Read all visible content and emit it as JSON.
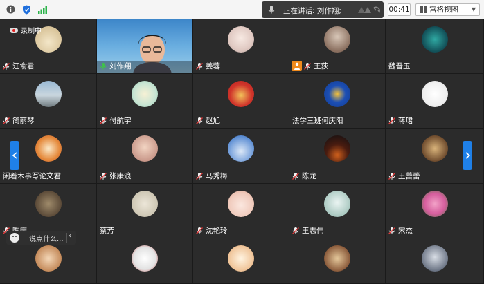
{
  "topbar": {
    "speaking_label": "正在讲话: 刘作翔;",
    "timer": "00:41",
    "view_label": "宫格视图"
  },
  "recording_label": "录制中",
  "chat": {
    "placeholder": "说点什么..."
  },
  "participants": [
    {
      "name": "汪俞君",
      "muted": true
    },
    {
      "name": "刘作翔",
      "muted": false,
      "video": true
    },
    {
      "name": "姜蓉",
      "muted": true
    },
    {
      "name": "王荻",
      "muted": true,
      "hand": true
    },
    {
      "name": "魏晋玉",
      "muted": false
    },
    {
      "name": "简丽琴",
      "muted": true
    },
    {
      "name": "付航宇",
      "muted": true
    },
    {
      "name": "赵旭",
      "muted": true
    },
    {
      "name": "法学三班何庆阳",
      "muted": false
    },
    {
      "name": "蒋珺",
      "muted": true
    },
    {
      "name": "闲着木事写论文君",
      "muted": false
    },
    {
      "name": "张康浪",
      "muted": true
    },
    {
      "name": "马秀梅",
      "muted": true
    },
    {
      "name": "陈龙",
      "muted": true
    },
    {
      "name": "王蕾蕾",
      "muted": true
    },
    {
      "name": "陶庆",
      "muted": true
    },
    {
      "name": "蔡芳",
      "muted": false
    },
    {
      "name": "沈艳玲",
      "muted": true
    },
    {
      "name": "王志伟",
      "muted": true
    },
    {
      "name": "宋杰",
      "muted": true
    },
    {
      "name": "",
      "muted": false
    },
    {
      "name": "",
      "muted": false
    },
    {
      "name": "",
      "muted": false
    },
    {
      "name": "",
      "muted": false
    },
    {
      "name": "",
      "muted": false
    }
  ],
  "colors": {
    "tile_bg": "#2b2b2b",
    "accent_blue": "#1f80e8",
    "hand_orange": "#f08a1c",
    "mic_green": "#3fc24a",
    "mic_red": "#e23b3b"
  }
}
